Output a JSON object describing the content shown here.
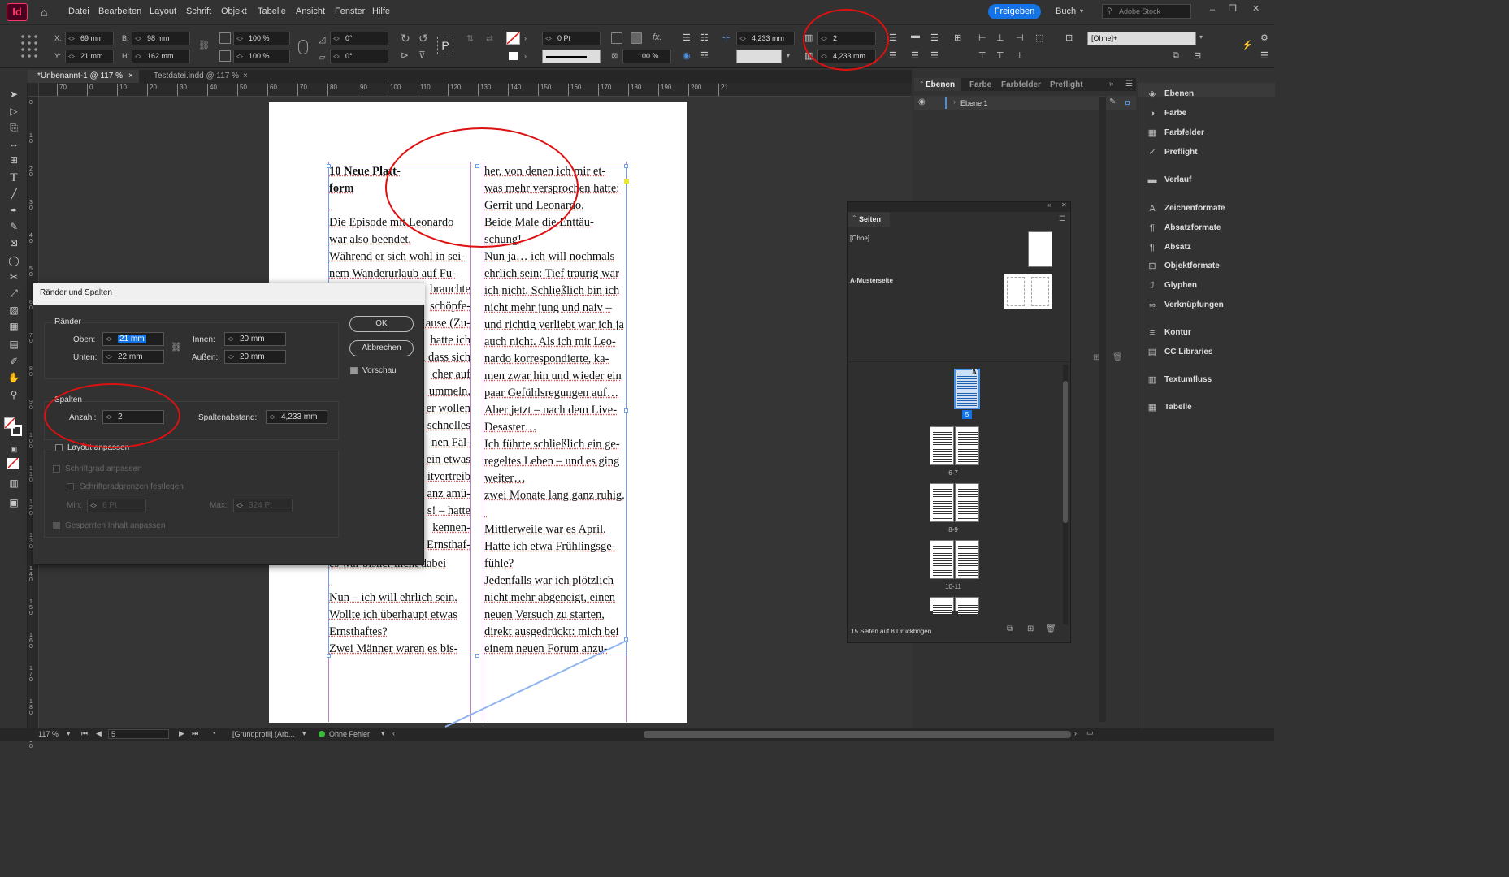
{
  "app": {
    "logo": "Id",
    "menus": [
      "Datei",
      "Bearbeiten",
      "Layout",
      "Schrift",
      "Objekt",
      "Tabelle",
      "Ansicht",
      "Fenster",
      "Hilfe"
    ],
    "share_button": "Freigeben",
    "workspace": "Buch",
    "search_placeholder": "Adobe Stock"
  },
  "control": {
    "x": "69 mm",
    "y": "21 mm",
    "w": "98 mm",
    "h": "162 mm",
    "scale_x": "100 %",
    "scale_y": "100 %",
    "angle": "0°",
    "shear": "0°",
    "stroke_weight": "0 Pt",
    "opacity": "100 %",
    "gutter": "4,233 mm",
    "columns": "2",
    "col_gutter": "4,233 mm",
    "style": "[Ohne]+",
    "labels": {
      "x": "X:",
      "y": "Y:",
      "w": "B:",
      "h": "H:"
    }
  },
  "tabs": [
    {
      "label": "*Unbenannt-1 @ 117 %",
      "close": "×"
    },
    {
      "label": "Testdatei.indd @ 117 %",
      "close": "×"
    }
  ],
  "ruler": {
    "h_ticks": [
      "70",
      "0",
      "10",
      "20",
      "30",
      "40",
      "50",
      "60",
      "70",
      "80",
      "90",
      "100",
      "110",
      "120",
      "130",
      "140",
      "150",
      "160",
      "170",
      "180",
      "190",
      "200",
      "21"
    ],
    "v_ticks": [
      "0",
      "1 0",
      "2 0",
      "3 0",
      "4 0",
      "5 0",
      "6 0",
      "7 0",
      "8 0",
      "9 0",
      "1 0 0",
      "1 1 0",
      "1 2 0",
      "1 3 0",
      "1 4 0",
      "1 5 0",
      "1 6 0",
      "1 7 0",
      "1 8 0",
      "1 9 0"
    ]
  },
  "document": {
    "left_column": [
      "10                  Neue Platt-",
      "form",
      "",
      "Die Episode mit Leonardo",
      "war also beendet.",
      "Während er sich wohl in sei-",
      "nem Wanderurlaub auf Fu-",
      "",
      "",
      "",
      "",
      "",
      "",
      "",
      "",
      "",
      "",
      "",
      "",
      "",
      "",
      "",
      "",
      "es war bisher nicht dabei",
      "",
      "Nun – ich will ehrlich sein.",
      "Wollte ich überhaupt etwas",
      "Ernsthaftes?",
      "Zwei Männer waren es bis-"
    ],
    "left_column_visible_fragments": [
      "brauchte",
      "schöpfe-",
      "ause (Zu-",
      "hatte ich",
      ", dass sich",
      "cher auf",
      "ummeln.",
      "er wollen",
      "schnelles",
      "nen Fäl-",
      "ein etwas",
      "itvertreib",
      "anz amü-",
      "s! – hatte",
      "kennen-",
      "Ernsthaf-"
    ],
    "right_column": [
      "her, von denen ich mir et-",
      "was mehr versprochen hatte:",
      "Gerrit und Leonardo.",
      "Beide Male die Enttäu-",
      "schung!",
      "Nun ja… ich will nochmals",
      "ehrlich sein: Tief traurig war",
      "ich nicht. Schließlich bin ich",
      "nicht mehr jung und naiv –",
      "und richtig verliebt war ich ja",
      "auch nicht. Als ich mit Leo-",
      "nardo korrespondierte, ka-",
      "men zwar hin und wieder ein",
      "paar Gefühlsregungen auf…",
      "Aber jetzt – nach dem Live-",
      "Desaster…",
      "Ich führte schließlich ein ge-",
      "regeltes Leben – und es ging",
      "weiter…",
      "zwei Monate lang ganz ruhig.",
      "",
      "Mittlerweile war es April.",
      "Hatte ich etwa Frühlingsge-",
      "fühle?",
      "Jedenfalls war ich plötzlich",
      "nicht mehr abgeneigt, einen",
      "neuen Versuch zu starten,",
      "direkt ausgedrückt: mich bei",
      "einem neuen Forum anzu-"
    ]
  },
  "dialog": {
    "title": "Ränder und Spalten",
    "margins_label": "Ränder",
    "top_label": "Oben:",
    "top": "21 mm",
    "bottom_label": "Unten:",
    "bottom": "22 mm",
    "inside_label": "Innen:",
    "inside": "20 mm",
    "outside_label": "Außen:",
    "outside": "20 mm",
    "columns_label": "Spalten",
    "count_label": "Anzahl:",
    "count": "2",
    "gutter_label": "Spaltenabstand:",
    "gutter": "4,233 mm",
    "ok": "OK",
    "cancel": "Abbrechen",
    "preview": "Vorschau",
    "layout_adjust": "Layout anpassen",
    "font_size_adjust": "Schriftgrad anpassen",
    "font_limits": "Schriftgradgrenzen festlegen",
    "min_label": "Min:",
    "min": "6 Pt",
    "max_label": "Max:",
    "max": "324 Pt",
    "locked_adjust": "Gesperrten Inhalt anpassen"
  },
  "panels": {
    "tabs": [
      "Ebenen",
      "Farbe",
      "Farbfelder",
      "Preflight"
    ],
    "layer": "Ebene 1"
  },
  "right_panel": [
    {
      "label": "Ebenen",
      "icon": "layers-icon"
    },
    {
      "label": "Farbe",
      "icon": "color-icon"
    },
    {
      "label": "Farbfelder",
      "icon": "swatches-icon"
    },
    {
      "label": "Preflight",
      "icon": "preflight-icon"
    },
    {
      "label": "Verlauf",
      "icon": "gradient-icon"
    },
    {
      "label": "Zeichenformate",
      "icon": "char-styles-icon"
    },
    {
      "label": "Absatzformate",
      "icon": "para-styles-icon"
    },
    {
      "label": "Absatz",
      "icon": "paragraph-icon"
    },
    {
      "label": "Objektformate",
      "icon": "object-styles-icon"
    },
    {
      "label": "Glyphen",
      "icon": "glyphs-icon"
    },
    {
      "label": "Verknüpfungen",
      "icon": "links-icon"
    },
    {
      "label": "Kontur",
      "icon": "stroke-icon"
    },
    {
      "label": "CC Libraries",
      "icon": "libraries-icon"
    },
    {
      "label": "Textumfluss",
      "icon": "text-wrap-icon"
    },
    {
      "label": "Tabelle",
      "icon": "table-icon"
    }
  ],
  "pages": {
    "title": "Seiten",
    "none": "[Ohne]",
    "master": "A-Musterseite",
    "current": "5",
    "spreads": [
      "6-7",
      "8-9",
      "10-11"
    ],
    "footer": "15 Seiten auf 8 Druckbögen",
    "master_letter": "A"
  },
  "status": {
    "zoom": "117 %",
    "page": "5",
    "profile": "[Grundprofil] (Arb...",
    "errors": "Ohne Fehler"
  },
  "colors": {
    "accent": "#1473e6",
    "annotation": "#dd1111",
    "frame": "#6fa0e8"
  }
}
